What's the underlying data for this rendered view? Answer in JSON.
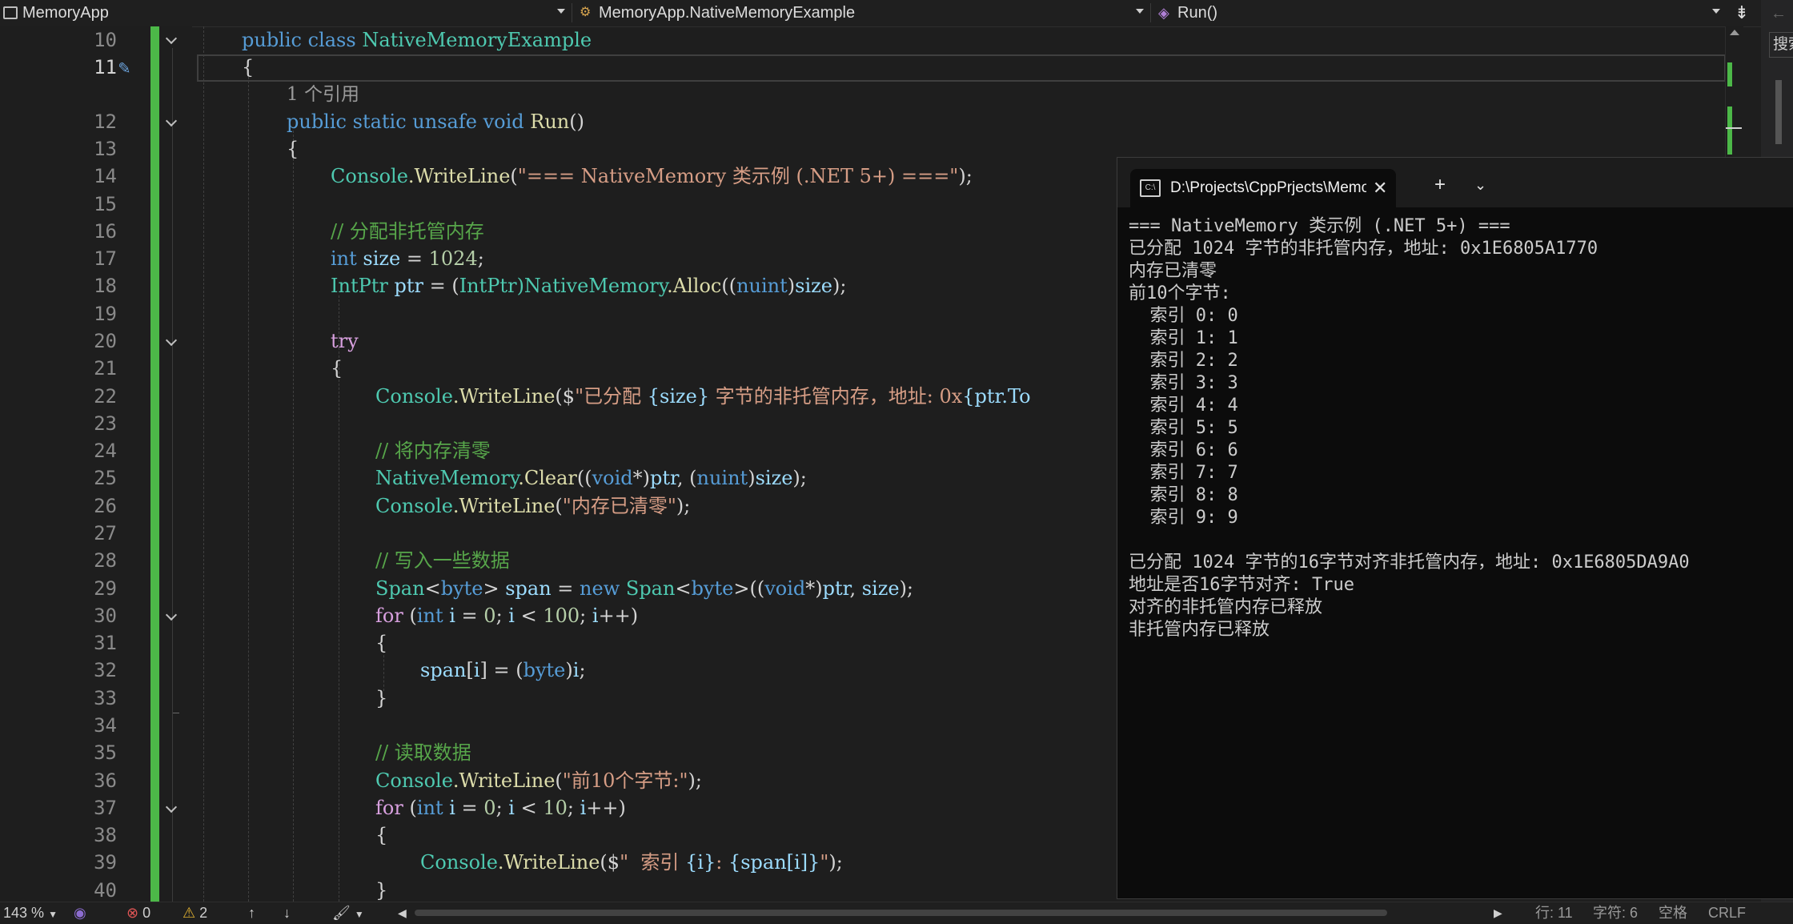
{
  "navbar": {
    "project": "MemoryApp",
    "class": "MemoryApp.NativeMemoryExample",
    "method": "Run()",
    "search_hint": "搜索"
  },
  "line_numbers": [
    "10",
    "11",
    "",
    "12",
    "13",
    "14",
    "15",
    "16",
    "17",
    "18",
    "19",
    "20",
    "21",
    "22",
    "23",
    "24",
    "25",
    "26",
    "27",
    "28",
    "29",
    "30",
    "31",
    "32",
    "33",
    "34",
    "35",
    "36",
    "37",
    "38",
    "39",
    "40"
  ],
  "code": {
    "l10": {
      "k1": "public",
      "k2": "class",
      "t": "NativeMemoryExample"
    },
    "l11": "{",
    "ref": "1 个引用",
    "l12": {
      "k1": "public",
      "k2": "static",
      "k3": "unsafe",
      "k4": "void",
      "m": "Run",
      "rest": "()"
    },
    "l13": "{",
    "l14": {
      "t": "Console",
      "m": ".WriteLine",
      "s": "\"=== NativeMemory 类示例 (.NET 5+) ===\"",
      "end": ");"
    },
    "l16": "// 分配非托管内存",
    "l17": {
      "k": "int",
      "v": "size",
      "op": " = ",
      "n": "1024",
      "end": ";"
    },
    "l18": {
      "t1": "IntPtr",
      "v1": " ptr",
      "op": " = (",
      "t2": "IntPtr",
      "t3": ")NativeMemory",
      "m": ".Alloc",
      "p1": "((",
      "k": "nuint",
      "p2": ")",
      "v2": "size",
      "end": ");"
    },
    "l20": "try",
    "l21": "{",
    "l22": {
      "t": "Console",
      "m": ".WriteLine",
      "p": "($",
      "s1": "\"已分配 ",
      "v": "{size}",
      "s2": " 字节的非托管内存，地址: 0x",
      "v2": "{ptr.To"
    },
    "l24": "// 将内存清零",
    "l25": {
      "t": "NativeMemory",
      "m": ".Clear",
      "p1": "((",
      "k1": "void",
      "p2": "*)",
      "v1": "ptr",
      "p3": ", (",
      "k2": "nuint",
      "p4": ")",
      "v2": "size",
      "end": ");"
    },
    "l26": {
      "t": "Console",
      "m": ".WriteLine",
      "p": "(",
      "s": "\"内存已清零\"",
      "end": ");"
    },
    "l28": "// 写入一些数据",
    "l29": {
      "t1": "Span",
      "p1": "<",
      "k1": "byte",
      "p2": "> ",
      "v1": "span",
      "op": " = ",
      "k2": "new",
      "t2": " Span",
      "p3": "<",
      "k3": "byte",
      "p4": ">((",
      "k4": "void",
      "p5": "*)",
      "v2": "ptr",
      "p6": ", ",
      "v3": "size",
      "end": ");"
    },
    "l30": {
      "k1": "for",
      "p1": " (",
      "k2": "int",
      "v1": " i",
      "p2": " = ",
      "n1": "0",
      "p3": "; ",
      "v2": "i",
      "p4": " < ",
      "n2": "100",
      "p5": "; ",
      "v3": "i",
      "end": "++)"
    },
    "l31": "{",
    "l32": {
      "v1": "span",
      "p1": "[",
      "v2": "i",
      "p2": "] = (",
      "k": "byte",
      "p3": ")",
      "v3": "i",
      "end": ";"
    },
    "l33": "}",
    "l35": "// 读取数据",
    "l36": {
      "t": "Console",
      "m": ".WriteLine",
      "p": "(",
      "s": "\"前10个字节:\"",
      "end": ");"
    },
    "l37": {
      "k1": "for",
      "p1": " (",
      "k2": "int",
      "v1": " i",
      "p2": " = ",
      "n1": "0",
      "p3": "; ",
      "v2": "i",
      "p4": " < ",
      "n2": "10",
      "p5": "; ",
      "v3": "i",
      "end": "++)"
    },
    "l38": "{",
    "l39": {
      "t": "Console",
      "m": ".WriteLine",
      "p": "($",
      "s1": "\"  索引 ",
      "v1": "{i}",
      "s2": ": ",
      "v2": "{span[i]}",
      "s3": "\"",
      "end": ");"
    },
    "l40": "}"
  },
  "console": {
    "title": "D:\\Projects\\CppPrjects\\Memo",
    "lines": [
      "=== NativeMemory 类示例 (.NET 5+) ===",
      "已分配 1024 字节的非托管内存，地址: 0x1E6805A1770",
      "内存已清零",
      "前10个字节:",
      "  索引 0: 0",
      "  索引 1: 1",
      "  索引 2: 2",
      "  索引 3: 3",
      "  索引 4: 4",
      "  索引 5: 5",
      "  索引 6: 6",
      "  索引 7: 7",
      "  索引 8: 8",
      "  索引 9: 9",
      "",
      "已分配 1024 字节的16字节对齐非托管内存，地址: 0x1E6805DA9A0",
      "地址是否16字节对齐: True",
      "对齐的非托管内存已释放",
      "非托管内存已释放"
    ]
  },
  "status": {
    "zoom": "143 %",
    "errors": "0",
    "warnings": "2",
    "line": "行: 11",
    "char": "字符: 6",
    "spaces": "空格",
    "eol": "CRLF"
  },
  "colors": {
    "keyword": "#569cd6",
    "type": "#4ec9b0",
    "string": "#d69d85",
    "comment": "#57a64a",
    "method": "#dcdcaa",
    "changebar": "#4cb848"
  }
}
